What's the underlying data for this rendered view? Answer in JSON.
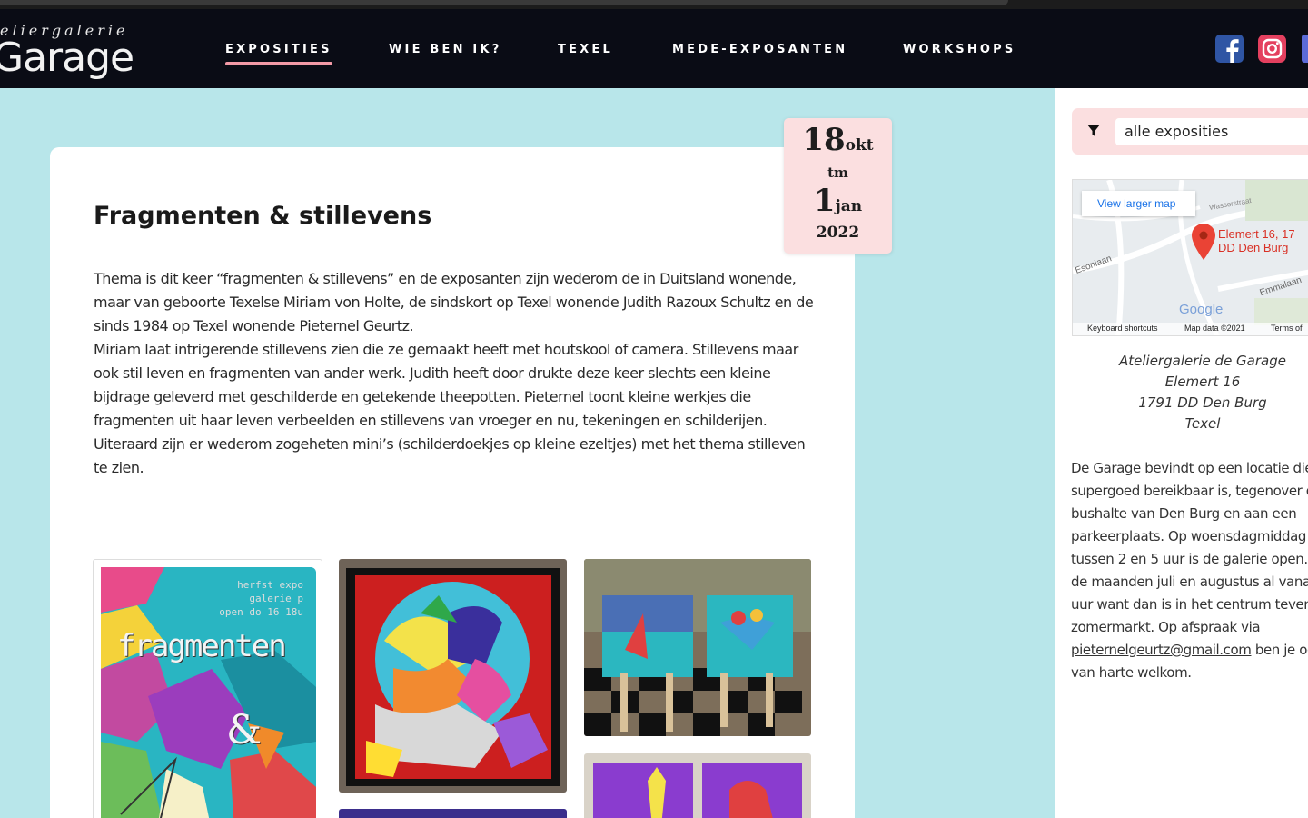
{
  "site": {
    "logo_small": "eliergalerie",
    "logo_big": "Garage"
  },
  "nav": {
    "items": [
      {
        "label": "EXPOSITIES",
        "active": true
      },
      {
        "label": "WIE BEN IK?"
      },
      {
        "label": "TEXEL"
      },
      {
        "label": "MEDE-EXPOSANTEN"
      },
      {
        "label": "WORKSHOPS"
      }
    ],
    "social": [
      "facebook-icon",
      "instagram-icon"
    ]
  },
  "exhibition": {
    "title": "Fragmenten & stillevens",
    "date": {
      "start_day": "18",
      "start_month": "okt",
      "separator": "tm",
      "end_day": "1",
      "end_month": "jan",
      "year": "2022"
    },
    "description": [
      "Thema is dit keer “fragmenten & stillevens” en de exposanten zijn wederom de in Duitsland wonende, maar van geboorte Texelse Miriam von Holte, de sindskort op Texel wonende Judith Razoux Schultz en de sinds 1984 op Texel wonende Pieternel Geurtz.",
      "Miriam laat intrigerende stillevens zien die ze gemaakt heeft met houtskool of camera. Stillevens maar ook stil leven en fragmenten van ander werk. Judith heeft door drukte deze keer slechts een kleine bijdrage geleverd met geschilderde en getekende theepotten. Pieternel toont kleine werkjes die fragmenten uit haar leven verbeelden en stillevens van vroeger en nu, tekeningen en schilderijen. Uiteraard zijn er wederom zogeheten mini’s (schilderdoekjes op kleine ezeltjes) met het thema stilleven te zien."
    ],
    "poster": {
      "header_lines": [
        "herfst expo",
        "galerie p",
        "open do 16 18u"
      ],
      "word": "fragmenten",
      "ampersand": "&"
    }
  },
  "sidebar": {
    "filter_value": "alle exposities",
    "map": {
      "link": "View larger map",
      "address_lines": [
        "Elemert 16, 17",
        "DD Den Burg"
      ],
      "google": "Google",
      "footer": [
        "Keyboard shortcuts",
        "Map data ©2021",
        "Terms of"
      ],
      "streets": [
        "Wasserstraat",
        "Emmalaan",
        "Esonlaan"
      ]
    },
    "address": [
      "Ateliergalerie de Garage",
      "Elemert 16",
      "1791 DD Den Burg",
      "Texel"
    ],
    "info_before_link": "De Garage bevindt op een locatie die supergoed bereikbaar is, tegenover de bushalte van Den Burg en aan een parkeerplaats. Op woensdagmiddag tussen 2 en 5 uur is de galerie open. In de maanden juli en augustus al vanaf 10 uur want dan is in het centrum tevens de zomermarkt. Op afspraak via",
    "info_link": "pieternelgeurtz@gmail.com",
    "info_after_link": "ben je ook van harte welkom."
  },
  "colors": {
    "navbar": "#0a0c15",
    "background": "#b8e6ea",
    "accent_pink": "#fbdfe0",
    "underline": "#f39aa6"
  }
}
